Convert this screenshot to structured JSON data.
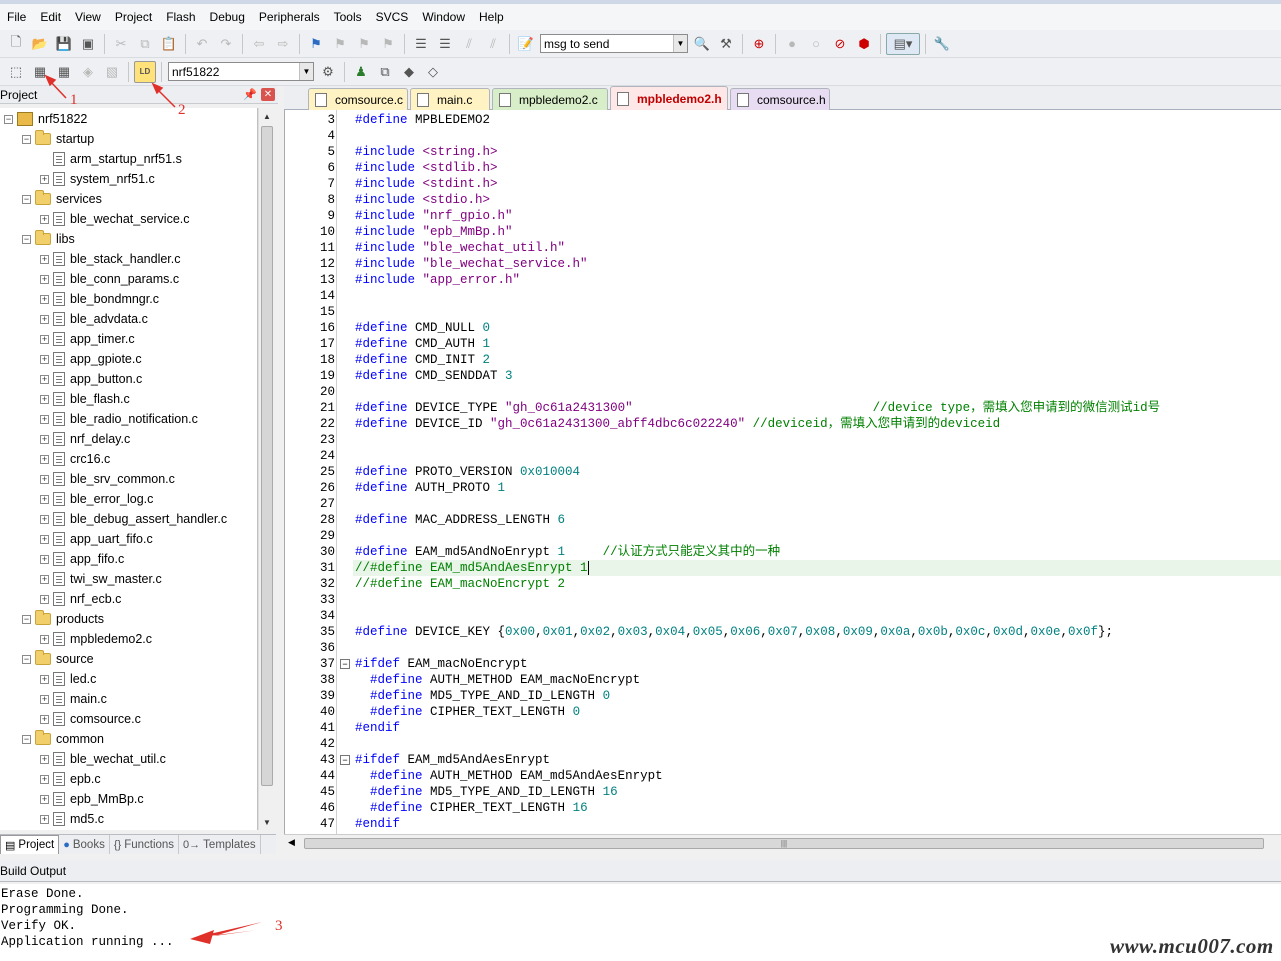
{
  "menu": [
    "File",
    "Edit",
    "View",
    "Project",
    "Flash",
    "Debug",
    "Peripherals",
    "Tools",
    "SVCS",
    "Window",
    "Help"
  ],
  "toolbar1": {
    "find_combo_value": "msg to send"
  },
  "toolbar2": {
    "target_combo_value": "nrf51822"
  },
  "project_panel": {
    "title": "Project",
    "tabs": [
      "Project",
      "Books",
      "Functions",
      "Templates"
    ],
    "tree": [
      {
        "label": "nrf51822",
        "level": 0,
        "kind": "root",
        "exp": "-"
      },
      {
        "label": "startup",
        "level": 1,
        "kind": "folder",
        "exp": "-"
      },
      {
        "label": "arm_startup_nrf51.s",
        "level": 2,
        "kind": "file",
        "exp": ""
      },
      {
        "label": "system_nrf51.c",
        "level": 2,
        "kind": "file",
        "exp": "+"
      },
      {
        "label": "services",
        "level": 1,
        "kind": "folder",
        "exp": "-"
      },
      {
        "label": "ble_wechat_service.c",
        "level": 2,
        "kind": "file",
        "exp": "+"
      },
      {
        "label": "libs",
        "level": 1,
        "kind": "folder",
        "exp": "-"
      },
      {
        "label": "ble_stack_handler.c",
        "level": 2,
        "kind": "file",
        "exp": "+"
      },
      {
        "label": "ble_conn_params.c",
        "level": 2,
        "kind": "file",
        "exp": "+"
      },
      {
        "label": "ble_bondmngr.c",
        "level": 2,
        "kind": "file",
        "exp": "+"
      },
      {
        "label": "ble_advdata.c",
        "level": 2,
        "kind": "file",
        "exp": "+"
      },
      {
        "label": "app_timer.c",
        "level": 2,
        "kind": "file",
        "exp": "+"
      },
      {
        "label": "app_gpiote.c",
        "level": 2,
        "kind": "file",
        "exp": "+"
      },
      {
        "label": "app_button.c",
        "level": 2,
        "kind": "file",
        "exp": "+"
      },
      {
        "label": "ble_flash.c",
        "level": 2,
        "kind": "file",
        "exp": "+"
      },
      {
        "label": "ble_radio_notification.c",
        "level": 2,
        "kind": "file",
        "exp": "+"
      },
      {
        "label": "nrf_delay.c",
        "level": 2,
        "kind": "file",
        "exp": "+"
      },
      {
        "label": "crc16.c",
        "level": 2,
        "kind": "file",
        "exp": "+"
      },
      {
        "label": "ble_srv_common.c",
        "level": 2,
        "kind": "file",
        "exp": "+"
      },
      {
        "label": "ble_error_log.c",
        "level": 2,
        "kind": "file",
        "exp": "+"
      },
      {
        "label": "ble_debug_assert_handler.c",
        "level": 2,
        "kind": "file",
        "exp": "+"
      },
      {
        "label": "app_uart_fifo.c",
        "level": 2,
        "kind": "file",
        "exp": "+"
      },
      {
        "label": "app_fifo.c",
        "level": 2,
        "kind": "file",
        "exp": "+"
      },
      {
        "label": "twi_sw_master.c",
        "level": 2,
        "kind": "file",
        "exp": "+"
      },
      {
        "label": "nrf_ecb.c",
        "level": 2,
        "kind": "file",
        "exp": "+"
      },
      {
        "label": "products",
        "level": 1,
        "kind": "folder",
        "exp": "-"
      },
      {
        "label": "mpbledemo2.c",
        "level": 2,
        "kind": "file",
        "exp": "+"
      },
      {
        "label": "source",
        "level": 1,
        "kind": "folder",
        "exp": "-"
      },
      {
        "label": "led.c",
        "level": 2,
        "kind": "file",
        "exp": "+"
      },
      {
        "label": "main.c",
        "level": 2,
        "kind": "file",
        "exp": "+"
      },
      {
        "label": "comsource.c",
        "level": 2,
        "kind": "file",
        "exp": "+"
      },
      {
        "label": "common",
        "level": 1,
        "kind": "folder",
        "exp": "-"
      },
      {
        "label": "ble_wechat_util.c",
        "level": 2,
        "kind": "file",
        "exp": "+"
      },
      {
        "label": "epb.c",
        "level": 2,
        "kind": "file",
        "exp": "+"
      },
      {
        "label": "epb_MmBp.c",
        "level": 2,
        "kind": "file",
        "exp": "+"
      },
      {
        "label": "md5.c",
        "level": 2,
        "kind": "file",
        "exp": "+"
      }
    ]
  },
  "editor_tabs": [
    {
      "label": "comsource.c",
      "kind": "c-file"
    },
    {
      "label": "main.c",
      "kind": "c-file"
    },
    {
      "label": "mpbledemo2.c",
      "kind": "demo-c"
    },
    {
      "label": "mpbledemo2.h",
      "kind": "active"
    },
    {
      "label": "comsource.h",
      "kind": "h-file"
    }
  ],
  "code": [
    {
      "n": "3",
      "t": [
        [
          "pp",
          "#define"
        ],
        [
          "",
          " MPBLEDEMO2"
        ]
      ]
    },
    {
      "n": "4",
      "t": []
    },
    {
      "n": "5",
      "t": [
        [
          "pp",
          "#include"
        ],
        [
          "",
          " "
        ],
        [
          "str",
          "<string.h>"
        ]
      ]
    },
    {
      "n": "6",
      "t": [
        [
          "pp",
          "#include"
        ],
        [
          "",
          " "
        ],
        [
          "str",
          "<stdlib.h>"
        ]
      ]
    },
    {
      "n": "7",
      "t": [
        [
          "pp",
          "#include"
        ],
        [
          "",
          " "
        ],
        [
          "str",
          "<stdint.h>"
        ]
      ]
    },
    {
      "n": "8",
      "t": [
        [
          "pp",
          "#include"
        ],
        [
          "",
          " "
        ],
        [
          "str",
          "<stdio.h>"
        ]
      ]
    },
    {
      "n": "9",
      "t": [
        [
          "pp",
          "#include"
        ],
        [
          "",
          " "
        ],
        [
          "str",
          "\"nrf_gpio.h\""
        ]
      ]
    },
    {
      "n": "10",
      "t": [
        [
          "pp",
          "#include"
        ],
        [
          "",
          " "
        ],
        [
          "str",
          "\"epb_MmBp.h\""
        ]
      ]
    },
    {
      "n": "11",
      "t": [
        [
          "pp",
          "#include"
        ],
        [
          "",
          " "
        ],
        [
          "str",
          "\"ble_wechat_util.h\""
        ]
      ]
    },
    {
      "n": "12",
      "t": [
        [
          "pp",
          "#include"
        ],
        [
          "",
          " "
        ],
        [
          "str",
          "\"ble_wechat_service.h\""
        ]
      ]
    },
    {
      "n": "13",
      "t": [
        [
          "pp",
          "#include"
        ],
        [
          "",
          " "
        ],
        [
          "str",
          "\"app_error.h\""
        ]
      ]
    },
    {
      "n": "14",
      "t": []
    },
    {
      "n": "15",
      "t": []
    },
    {
      "n": "16",
      "t": [
        [
          "pp",
          "#define"
        ],
        [
          "",
          " CMD_NULL "
        ],
        [
          "num",
          "0"
        ]
      ]
    },
    {
      "n": "17",
      "t": [
        [
          "pp",
          "#define"
        ],
        [
          "",
          " CMD_AUTH "
        ],
        [
          "num",
          "1"
        ]
      ]
    },
    {
      "n": "18",
      "t": [
        [
          "pp",
          "#define"
        ],
        [
          "",
          " CMD_INIT "
        ],
        [
          "num",
          "2"
        ]
      ]
    },
    {
      "n": "19",
      "t": [
        [
          "pp",
          "#define"
        ],
        [
          "",
          " CMD_SENDDAT "
        ],
        [
          "num",
          "3"
        ]
      ]
    },
    {
      "n": "20",
      "t": []
    },
    {
      "n": "21",
      "t": [
        [
          "pp",
          "#define"
        ],
        [
          "",
          " DEVICE_TYPE "
        ],
        [
          "str",
          "\"gh_0c61a2431300\""
        ],
        [
          "",
          "                                "
        ],
        [
          "cmt",
          "//device type，需填入您申请到的微信测试id号"
        ]
      ]
    },
    {
      "n": "22",
      "t": [
        [
          "pp",
          "#define"
        ],
        [
          "",
          " DEVICE_ID "
        ],
        [
          "str",
          "\"gh_0c61a2431300_abff4dbc6c022240\""
        ],
        [
          "",
          " "
        ],
        [
          "cmt",
          "//deviceid，需填入您申请到的deviceid"
        ]
      ]
    },
    {
      "n": "23",
      "t": []
    },
    {
      "n": "24",
      "t": []
    },
    {
      "n": "25",
      "t": [
        [
          "pp",
          "#define"
        ],
        [
          "",
          " PROTO_VERSION "
        ],
        [
          "num",
          "0x010004"
        ]
      ]
    },
    {
      "n": "26",
      "t": [
        [
          "pp",
          "#define"
        ],
        [
          "",
          " AUTH_PROTO "
        ],
        [
          "num",
          "1"
        ]
      ]
    },
    {
      "n": "27",
      "t": []
    },
    {
      "n": "28",
      "t": [
        [
          "pp",
          "#define"
        ],
        [
          "",
          " MAC_ADDRESS_LENGTH "
        ],
        [
          "num",
          "6"
        ]
      ]
    },
    {
      "n": "29",
      "t": []
    },
    {
      "n": "30",
      "t": [
        [
          "pp",
          "#define"
        ],
        [
          "",
          " EAM_md5AndNoEnrypt "
        ],
        [
          "num",
          "1"
        ],
        [
          "",
          "     "
        ],
        [
          "cmt",
          "//认证方式只能定义其中的一种"
        ]
      ]
    },
    {
      "n": "31",
      "t": [
        [
          "cmt",
          "//#define EAM_md5AndAesEnrypt 1"
        ]
      ],
      "current": true
    },
    {
      "n": "32",
      "t": [
        [
          "cmt",
          "//#define EAM_macNoEncrypt 2"
        ]
      ]
    },
    {
      "n": "33",
      "t": []
    },
    {
      "n": "34",
      "t": []
    },
    {
      "n": "35",
      "t": [
        [
          "pp",
          "#define"
        ],
        [
          "",
          " DEVICE_KEY {"
        ],
        [
          "num",
          "0x00"
        ],
        [
          "",
          ","
        ],
        [
          "num",
          "0x01"
        ],
        [
          "",
          ","
        ],
        [
          "num",
          "0x02"
        ],
        [
          "",
          ","
        ],
        [
          "num",
          "0x03"
        ],
        [
          "",
          ","
        ],
        [
          "num",
          "0x04"
        ],
        [
          "",
          ","
        ],
        [
          "num",
          "0x05"
        ],
        [
          "",
          ","
        ],
        [
          "num",
          "0x06"
        ],
        [
          "",
          ","
        ],
        [
          "num",
          "0x07"
        ],
        [
          "",
          ","
        ],
        [
          "num",
          "0x08"
        ],
        [
          "",
          ","
        ],
        [
          "num",
          "0x09"
        ],
        [
          "",
          ","
        ],
        [
          "num",
          "0x0a"
        ],
        [
          "",
          ","
        ],
        [
          "num",
          "0x0b"
        ],
        [
          "",
          ","
        ],
        [
          "num",
          "0x0c"
        ],
        [
          "",
          ","
        ],
        [
          "num",
          "0x0d"
        ],
        [
          "",
          ","
        ],
        [
          "num",
          "0x0e"
        ],
        [
          "",
          ","
        ],
        [
          "num",
          "0x0f"
        ],
        [
          "",
          "};"
        ]
      ]
    },
    {
      "n": "36",
      "t": []
    },
    {
      "n": "37",
      "t": [
        [
          "pp",
          "#ifdef"
        ],
        [
          "",
          " EAM_macNoEncrypt"
        ]
      ],
      "fold": "-"
    },
    {
      "n": "38",
      "t": [
        [
          "",
          "  "
        ],
        [
          "pp",
          "#define"
        ],
        [
          "",
          " AUTH_METHOD EAM_macNoEncrypt"
        ]
      ]
    },
    {
      "n": "39",
      "t": [
        [
          "",
          "  "
        ],
        [
          "pp",
          "#define"
        ],
        [
          "",
          " MD5_TYPE_AND_ID_LENGTH "
        ],
        [
          "num",
          "0"
        ]
      ]
    },
    {
      "n": "40",
      "t": [
        [
          "",
          "  "
        ],
        [
          "pp",
          "#define"
        ],
        [
          "",
          " CIPHER_TEXT_LENGTH "
        ],
        [
          "num",
          "0"
        ]
      ]
    },
    {
      "n": "41",
      "t": [
        [
          "pp",
          "#endif"
        ]
      ]
    },
    {
      "n": "42",
      "t": []
    },
    {
      "n": "43",
      "t": [
        [
          "pp",
          "#ifdef"
        ],
        [
          "",
          " EAM_md5AndAesEnrypt"
        ]
      ],
      "fold": "-"
    },
    {
      "n": "44",
      "t": [
        [
          "",
          "  "
        ],
        [
          "pp",
          "#define"
        ],
        [
          "",
          " AUTH_METHOD EAM_md5AndAesEnrypt"
        ]
      ]
    },
    {
      "n": "45",
      "t": [
        [
          "",
          "  "
        ],
        [
          "pp",
          "#define"
        ],
        [
          "",
          " MD5_TYPE_AND_ID_LENGTH "
        ],
        [
          "num",
          "16"
        ]
      ]
    },
    {
      "n": "46",
      "t": [
        [
          "",
          "  "
        ],
        [
          "pp",
          "#define"
        ],
        [
          "",
          " CIPHER_TEXT_LENGTH "
        ],
        [
          "num",
          "16"
        ]
      ]
    },
    {
      "n": "47",
      "t": [
        [
          "pp",
          "#endif"
        ]
      ]
    }
  ],
  "build_output": {
    "title": "Build Output",
    "lines": [
      "Erase Done.",
      "Programming Done.",
      "Verify OK.",
      "Application running ..."
    ]
  },
  "annotations": {
    "n1": "1",
    "n2": "2",
    "n3": "3",
    "color": "#e0302a"
  },
  "watermark": "www.mcu007.com"
}
